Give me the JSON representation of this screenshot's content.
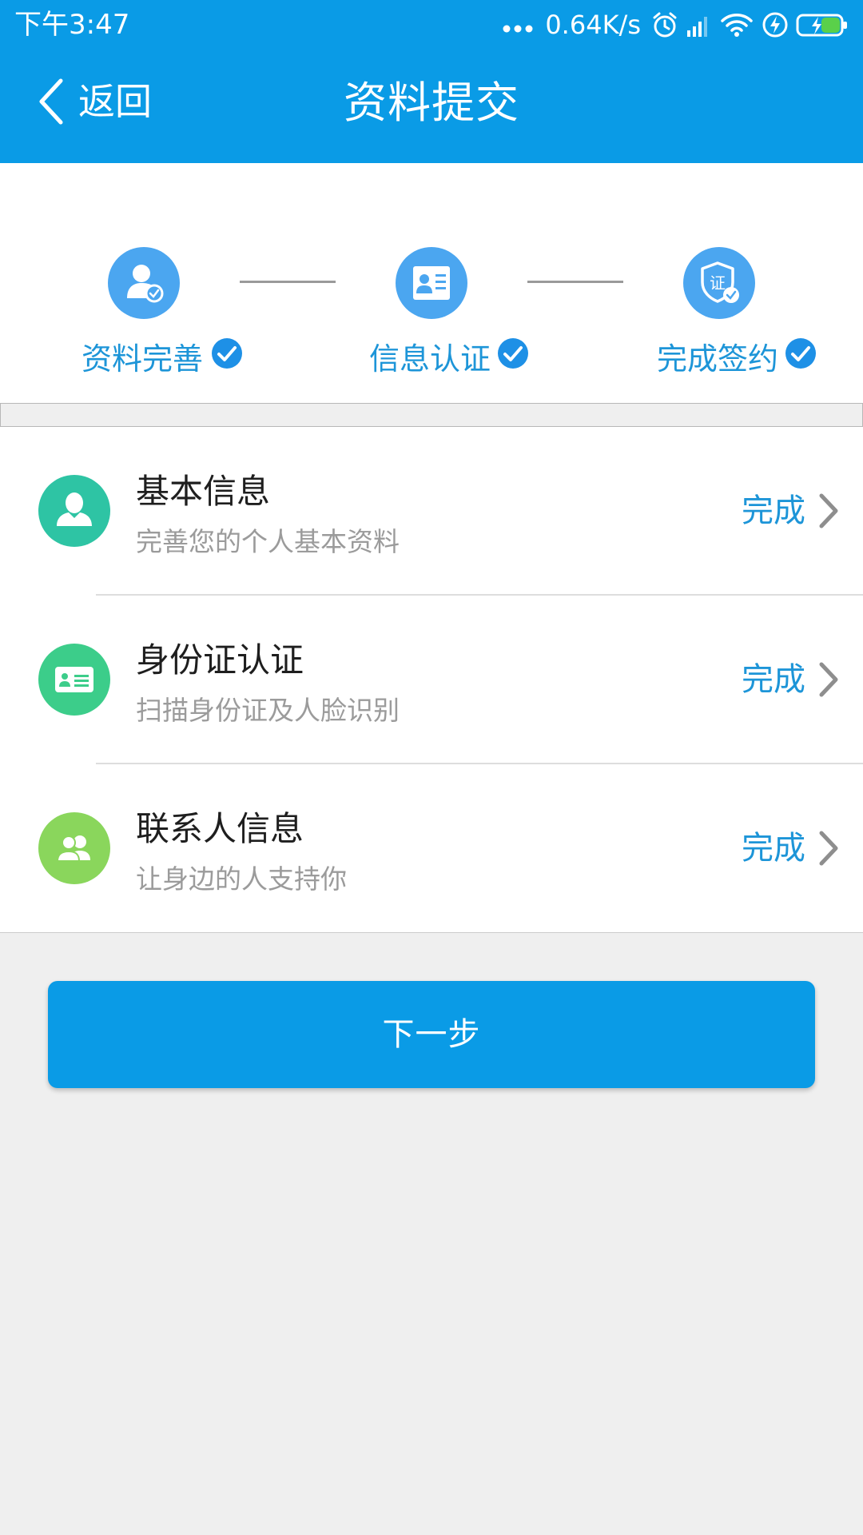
{
  "colors": {
    "primary": "#0a9be6",
    "step_circle": "#4ba6f0",
    "step_text": "#1d95d8",
    "check": "#1e90e6",
    "status_text": "#1d95d8",
    "item_icon_basic": "#2ec4a4",
    "item_icon_id": "#3ccd8a",
    "item_icon_contacts": "#8ad65c",
    "background": "#efefef"
  },
  "status_bar": {
    "time": "下午3:47",
    "network_speed": "0.64K/s",
    "icons": [
      "more-dots-icon",
      "alarm-icon",
      "signal-icon",
      "wifi-icon",
      "charging-bolt-icon",
      "battery-icon"
    ]
  },
  "header": {
    "back_label": "返回",
    "title": "资料提交"
  },
  "steps": [
    {
      "label": "资料完善",
      "icon": "user-check-icon",
      "completed": true
    },
    {
      "label": "信息认证",
      "icon": "id-card-icon",
      "completed": true
    },
    {
      "label": "完成签约",
      "icon": "certificate-shield-icon",
      "icon_text": "证",
      "completed": true
    }
  ],
  "items": [
    {
      "title": "基本信息",
      "subtitle": "完善您的个人基本资料",
      "status": "完成",
      "icon": "person-icon"
    },
    {
      "title": "身份证认证",
      "subtitle": "扫描身份证及人脸识别",
      "status": "完成",
      "icon": "id-card-icon"
    },
    {
      "title": "联系人信息",
      "subtitle": "让身边的人支持你",
      "status": "完成",
      "icon": "contacts-icon"
    }
  ],
  "next_button": {
    "label": "下一步"
  }
}
